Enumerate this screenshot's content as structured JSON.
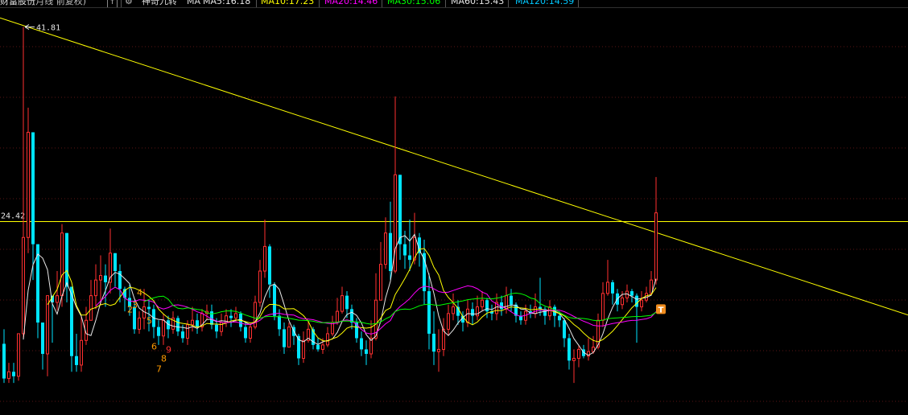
{
  "header": {
    "stock_name": "财富股份",
    "period_info": "(月线 前复权)",
    "indicator_name": "神奇九转",
    "ma_label": "MA",
    "ma_items": [
      {
        "label": "MA5:16.18",
        "color": "#e8e8e8"
      },
      {
        "label": "MA10:17.23",
        "color": "#ffff00"
      },
      {
        "label": "MA20:14.46",
        "color": "#ff00ff"
      },
      {
        "label": "MA30:15.06",
        "color": "#00ff00"
      },
      {
        "label": "MA60:15.43",
        "color": "#e8e8e8"
      },
      {
        "label": "MA120:14.59",
        "color": "#00c8ff"
      }
    ],
    "icon_up": "arrow-up-icon",
    "icon_settings": "gear-icon"
  },
  "chart_data": {
    "type": "candlestick",
    "y_range": [
      8,
      43.5
    ],
    "high_marker": {
      "label": "41.81",
      "value": 41.81,
      "bar": 4
    },
    "price_line": {
      "label": "24.42",
      "value": 24.42
    },
    "trendline": {
      "from": {
        "bar": 0,
        "value": 42.5
      },
      "to": {
        "bar": 136,
        "value": 23.3
      }
    },
    "colors": {
      "up": "#ff3030",
      "down": "#00e5ff",
      "trendline": "#ffff00",
      "price_line": "#ffff00",
      "grid": "#5a1515"
    },
    "candles": [
      [
        13.5,
        10.4,
        14.8,
        10.0
      ],
      [
        10.4,
        11.0,
        11.8,
        10.0
      ],
      [
        11.0,
        10.6,
        11.8,
        10.0
      ],
      [
        10.6,
        14.4,
        14.4,
        10.2
      ],
      [
        14.4,
        23.0,
        41.81,
        14.0
      ],
      [
        23.0,
        32.4,
        34.6,
        21.6
      ],
      [
        32.4,
        22.4,
        23.0,
        19.2
      ],
      [
        22.4,
        15.4,
        20.4,
        14.0
      ],
      [
        15.4,
        12.6,
        14.4,
        11.2
      ],
      [
        12.6,
        17.8,
        17.8,
        10.6
      ],
      [
        17.8,
        17.2,
        17.8,
        13.6
      ],
      [
        17.2,
        17.8,
        20.0,
        16.5
      ],
      [
        17.8,
        23.4,
        24.2,
        16.8
      ],
      [
        23.4,
        18.6,
        23.4,
        17.2
      ],
      [
        18.6,
        12.4,
        18.6,
        11.0
      ],
      [
        12.4,
        11.6,
        14.4,
        11.0
      ],
      [
        11.6,
        13.8,
        16.0,
        11.0
      ],
      [
        13.8,
        15.6,
        16.8,
        13.4
      ],
      [
        15.6,
        17.8,
        19.2,
        15.6
      ],
      [
        17.8,
        19.2,
        20.6,
        16.6
      ],
      [
        19.2,
        19.6,
        21.4,
        17.0
      ],
      [
        19.6,
        19.0,
        20.6,
        16.8
      ],
      [
        19.0,
        21.6,
        23.8,
        18.0
      ],
      [
        21.6,
        20.0,
        21.6,
        18.6
      ],
      [
        20.0,
        18.4,
        20.6,
        17.2
      ],
      [
        18.4,
        17.6,
        18.6,
        16.4
      ],
      [
        17.6,
        16.8,
        18.8,
        16.0
      ],
      [
        16.8,
        14.8,
        17.4,
        14.4
      ],
      [
        14.8,
        15.8,
        16.4,
        14.4
      ],
      [
        15.8,
        16.8,
        18.4,
        14.8
      ],
      [
        16.8,
        16.6,
        17.4,
        14.6
      ],
      [
        16.6,
        15.0,
        17.0,
        14.0
      ],
      [
        15.0,
        14.2,
        15.6,
        13.4
      ],
      [
        14.2,
        15.6,
        16.2,
        13.4
      ],
      [
        15.6,
        14.8,
        16.0,
        14.0
      ],
      [
        14.8,
        15.8,
        16.4,
        14.4
      ],
      [
        15.8,
        14.6,
        16.0,
        14.2
      ],
      [
        14.6,
        14.0,
        15.2,
        13.6
      ],
      [
        14.0,
        15.2,
        15.6,
        13.4
      ],
      [
        15.2,
        15.6,
        16.8,
        14.6
      ],
      [
        15.6,
        15.0,
        16.2,
        14.4
      ],
      [
        15.0,
        16.2,
        16.6,
        14.6
      ],
      [
        16.2,
        16.4,
        17.0,
        15.6
      ],
      [
        16.4,
        15.2,
        17.0,
        14.8
      ],
      [
        15.2,
        14.6,
        15.8,
        14.0
      ],
      [
        14.6,
        15.4,
        16.2,
        14.2
      ],
      [
        15.4,
        16.0,
        16.6,
        15.0
      ],
      [
        16.0,
        15.8,
        16.6,
        15.0
      ],
      [
        15.8,
        16.2,
        16.8,
        15.4
      ],
      [
        16.2,
        15.0,
        16.4,
        14.6
      ],
      [
        15.0,
        14.0,
        15.4,
        13.6
      ],
      [
        14.0,
        15.0,
        15.4,
        13.6
      ],
      [
        15.0,
        17.2,
        17.8,
        14.8
      ],
      [
        17.2,
        20.0,
        21.0,
        16.8
      ],
      [
        20.0,
        22.2,
        24.6,
        19.4
      ],
      [
        22.2,
        18.8,
        22.4,
        17.6
      ],
      [
        18.8,
        16.0,
        19.0,
        15.6
      ],
      [
        16.0,
        14.8,
        16.6,
        14.2
      ],
      [
        14.8,
        13.2,
        15.4,
        12.6
      ],
      [
        13.2,
        15.0,
        15.4,
        13.2
      ],
      [
        15.0,
        14.2,
        15.2,
        13.4
      ],
      [
        14.2,
        12.2,
        14.4,
        11.6
      ],
      [
        12.2,
        13.8,
        14.6,
        11.8
      ],
      [
        13.8,
        14.8,
        15.6,
        13.6
      ],
      [
        14.8,
        13.4,
        15.0,
        13.0
      ],
      [
        13.4,
        13.0,
        14.0,
        12.8
      ],
      [
        13.0,
        13.4,
        14.0,
        12.6
      ],
      [
        13.4,
        14.4,
        15.0,
        13.2
      ],
      [
        14.4,
        15.4,
        16.0,
        14.2
      ],
      [
        15.4,
        16.4,
        17.6,
        15.2
      ],
      [
        16.4,
        17.8,
        18.6,
        16.2
      ],
      [
        17.8,
        16.6,
        18.2,
        15.8
      ],
      [
        16.6,
        15.4,
        17.0,
        14.8
      ],
      [
        15.4,
        14.0,
        15.8,
        13.6
      ],
      [
        14.0,
        13.0,
        14.6,
        12.4
      ],
      [
        13.0,
        12.6,
        13.8,
        11.6
      ],
      [
        12.6,
        14.0,
        15.6,
        12.2
      ],
      [
        14.0,
        17.4,
        19.8,
        13.8
      ],
      [
        17.4,
        20.6,
        22.6,
        17.4
      ],
      [
        20.6,
        23.4,
        24.8,
        20.2
      ],
      [
        23.4,
        20.0,
        26.2,
        19.2
      ],
      [
        20.0,
        28.6,
        35.6,
        19.8
      ],
      [
        28.6,
        22.4,
        28.6,
        21.0
      ],
      [
        22.4,
        21.4,
        23.6,
        20.2
      ],
      [
        21.4,
        21.0,
        24.6,
        20.0
      ],
      [
        21.0,
        23.0,
        25.2,
        20.6
      ],
      [
        23.0,
        21.6,
        23.4,
        20.4
      ],
      [
        21.6,
        18.2,
        22.8,
        17.0
      ],
      [
        18.2,
        14.4,
        19.8,
        13.0
      ],
      [
        14.4,
        12.8,
        16.4,
        11.6
      ],
      [
        12.8,
        13.0,
        14.8,
        11.0
      ],
      [
        13.0,
        14.8,
        15.8,
        12.4
      ],
      [
        14.8,
        16.2,
        17.0,
        14.2
      ],
      [
        16.2,
        16.8,
        18.0,
        15.6
      ],
      [
        16.8,
        16.0,
        17.4,
        15.2
      ],
      [
        16.0,
        15.4,
        16.4,
        14.6
      ],
      [
        15.4,
        16.6,
        17.4,
        15.0
      ],
      [
        16.6,
        16.0,
        17.2,
        15.2
      ],
      [
        16.0,
        16.8,
        17.8,
        15.6
      ],
      [
        16.8,
        17.4,
        18.2,
        16.4
      ],
      [
        17.4,
        16.4,
        17.6,
        15.8
      ],
      [
        16.4,
        16.2,
        17.0,
        15.6
      ],
      [
        16.2,
        17.2,
        18.0,
        15.6
      ],
      [
        17.2,
        16.6,
        17.8,
        16.0
      ],
      [
        16.6,
        17.8,
        18.6,
        16.2
      ],
      [
        17.8,
        17.0,
        18.4,
        16.4
      ],
      [
        17.0,
        16.0,
        17.2,
        15.4
      ],
      [
        16.0,
        15.6,
        16.4,
        15.2
      ],
      [
        15.6,
        16.4,
        17.0,
        15.2
      ],
      [
        16.4,
        16.2,
        17.0,
        15.8
      ],
      [
        16.2,
        16.8,
        18.0,
        15.8
      ],
      [
        16.8,
        16.6,
        19.4,
        16.0
      ],
      [
        16.6,
        16.0,
        16.8,
        15.2
      ],
      [
        16.0,
        16.8,
        17.4,
        15.6
      ],
      [
        16.8,
        16.0,
        17.0,
        15.0
      ],
      [
        16.0,
        15.6,
        16.4,
        15.0
      ],
      [
        15.6,
        14.0,
        15.8,
        13.2
      ],
      [
        14.0,
        12.0,
        14.4,
        11.2
      ],
      [
        12.0,
        12.2,
        13.0,
        10.0
      ],
      [
        12.2,
        13.0,
        13.4,
        11.4
      ],
      [
        13.0,
        12.4,
        13.4,
        12.2
      ],
      [
        12.4,
        12.8,
        14.0,
        12.0
      ],
      [
        12.8,
        13.2,
        14.2,
        12.6
      ],
      [
        13.2,
        15.6,
        16.2,
        13.0
      ],
      [
        15.6,
        18.0,
        19.0,
        15.0
      ],
      [
        18.0,
        19.0,
        21.0,
        17.8
      ],
      [
        19.0,
        18.0,
        19.2,
        17.0
      ],
      [
        18.0,
        17.0,
        18.4,
        16.4
      ],
      [
        17.0,
        17.6,
        18.2,
        16.6
      ],
      [
        17.6,
        18.2,
        18.8,
        17.2
      ],
      [
        18.2,
        17.8,
        18.4,
        17.2
      ],
      [
        17.8,
        16.8,
        18.0,
        13.6
      ],
      [
        16.8,
        17.4,
        18.2,
        16.4
      ],
      [
        17.4,
        18.0,
        18.6,
        17.2
      ],
      [
        18.0,
        19.2,
        20.0,
        17.8
      ],
      [
        19.2,
        25.2,
        28.4,
        18.8
      ]
    ],
    "ma_lines": [
      {
        "name": "MA5",
        "color": "#e8e8e8"
      },
      {
        "name": "MA10",
        "color": "#ffff00"
      },
      {
        "name": "MA20",
        "color": "#ff00ff"
      },
      {
        "name": "MA30",
        "color": "#00ff00"
      }
    ],
    "td_sequence": {
      "color": "#ff9a00",
      "items": [
        {
          "label": "2",
          "bar": 26,
          "value": 16.3
        },
        {
          "label": "3",
          "bar": 27,
          "value": 16.7
        },
        {
          "label": "4",
          "bar": 28,
          "value": 17.8
        },
        {
          "label": "5",
          "bar": 30,
          "value": 15.3
        },
        {
          "label": "6",
          "bar": 31,
          "value": 13.0
        },
        {
          "label": "7",
          "bar": 32,
          "value": 11.0
        },
        {
          "label": "8",
          "bar": 33,
          "value": 11.9
        },
        {
          "label": "9",
          "bar": 34,
          "value": 12.7
        }
      ]
    },
    "badge": {
      "label": "T",
      "bar": 136,
      "value": 16.6,
      "color": "#f08c1e"
    }
  }
}
